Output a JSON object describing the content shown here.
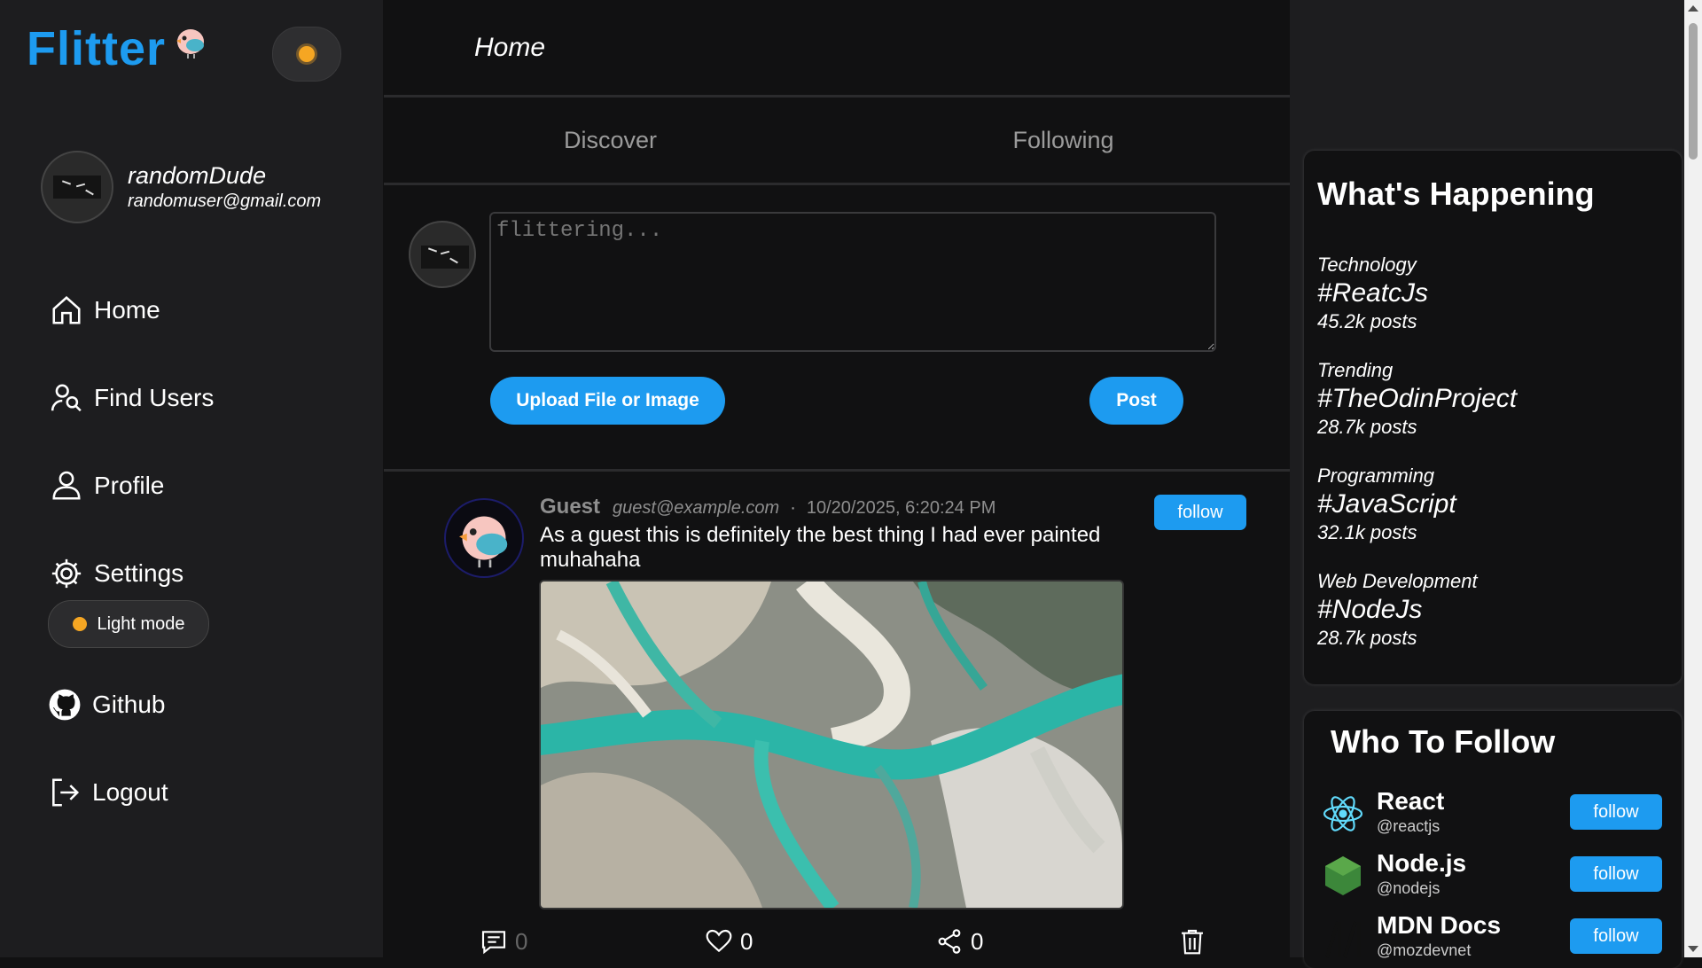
{
  "app": {
    "logo": "Flitter"
  },
  "user": {
    "name": "randomDude",
    "email": "randomuser@gmail.com"
  },
  "nav": [
    {
      "label": "Home",
      "icon": "home-icon"
    },
    {
      "label": "Find Users",
      "icon": "find-users-icon"
    },
    {
      "label": "Profile",
      "icon": "profile-icon"
    },
    {
      "label": "Settings",
      "icon": "gear-icon"
    }
  ],
  "mode_toggle": {
    "label": "Light mode"
  },
  "nav2": [
    {
      "label": "Github",
      "icon": "github-icon"
    },
    {
      "label": "Logout",
      "icon": "logout-icon"
    }
  ],
  "header": {
    "title": "Home"
  },
  "tabs": [
    "Discover",
    "Following"
  ],
  "compose": {
    "placeholder": "flittering...",
    "upload_label": "Upload File or Image",
    "post_label": "Post"
  },
  "tweet": {
    "name": "Guest",
    "email": "guest@example.com",
    "separator": "·",
    "time": "10/20/2025, 6:20:24 PM",
    "text": "As a guest this is definitely the best thing I had ever painted muhahaha",
    "follow_label": "follow",
    "comments": "0",
    "likes": "0",
    "shares": "0"
  },
  "whats_happening": {
    "title": "What's Happening",
    "items": [
      {
        "category": "Technology",
        "tag": "#ReatcJs",
        "count": "45.2k posts"
      },
      {
        "category": "Trending",
        "tag": "#TheOdinProject",
        "count": "28.7k posts"
      },
      {
        "category": "Programming",
        "tag": "#JavaScript",
        "count": "32.1k posts"
      },
      {
        "category": "Web Development",
        "tag": "#NodeJs",
        "count": "28.7k posts"
      }
    ]
  },
  "who_to_follow": {
    "title": "Who To Follow",
    "items": [
      {
        "name": "React",
        "handle": "@reactjs",
        "follow": "follow",
        "icon": "react-icon"
      },
      {
        "name": "Node.js",
        "handle": "@nodejs",
        "follow": "follow",
        "icon": "nodejs-icon"
      },
      {
        "name": "MDN Docs",
        "handle": "@mozdevnet",
        "follow": "follow",
        "icon": "mdn-icon"
      }
    ]
  },
  "colors": {
    "accent": "#1d9bf0",
    "sidebar": "#1d1d1f",
    "background": "#111112"
  }
}
